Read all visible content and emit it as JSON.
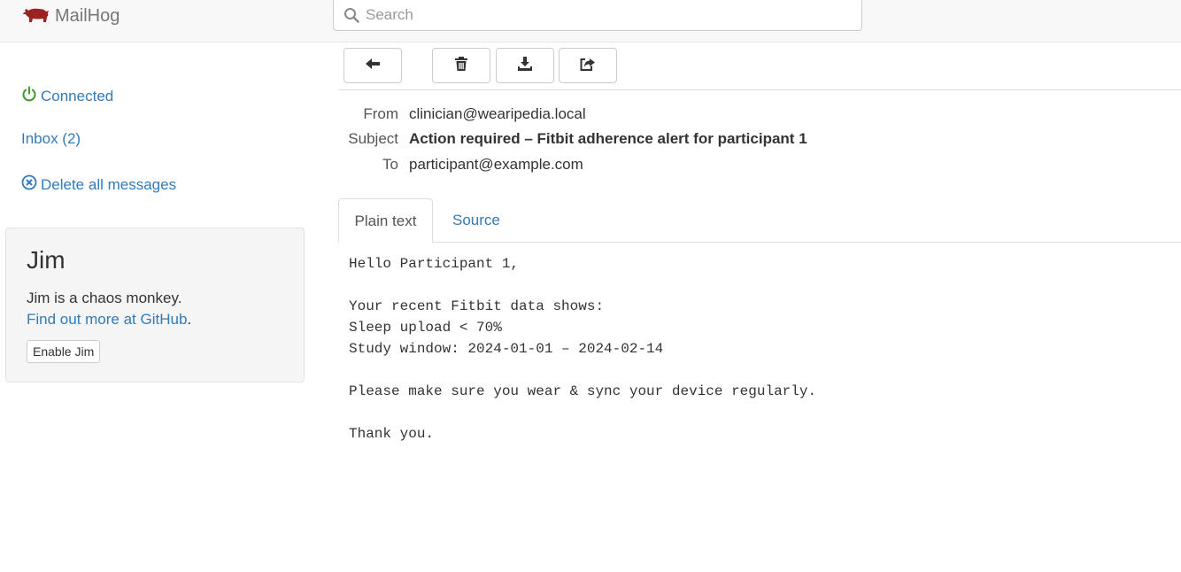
{
  "app": {
    "name": "MailHog"
  },
  "search": {
    "placeholder": "Search",
    "value": ""
  },
  "sidebar": {
    "connected": "Connected",
    "inbox": "Inbox (2)",
    "delete_all": "Delete all messages",
    "status_color": "#3c9a2c"
  },
  "jim": {
    "title": "Jim",
    "description": "Jim is a chaos monkey.",
    "link": "Find out more at GitHub",
    "link_suffix": ".",
    "button": "Enable Jim"
  },
  "toolbar": {
    "buttons": [
      {
        "icon": "back-arrow-icon"
      },
      {
        "icon": "trash-icon"
      },
      {
        "icon": "download-icon"
      },
      {
        "icon": "share-icon"
      }
    ]
  },
  "message": {
    "headers": {
      "from_label": "From",
      "from_value": "clinician@wearipedia.local",
      "subject_label": "Subject",
      "subject_value": "Action required – Fitbit adherence alert for participant 1",
      "to_label": "To",
      "to_value": "participant@example.com"
    },
    "tabs": [
      {
        "label": "Plain text",
        "active": true
      },
      {
        "label": "Source",
        "active": false
      }
    ],
    "body": "Hello Participant 1,\n\nYour recent Fitbit data shows:\nSleep upload < 70%\nStudy window: 2024-01-01 – 2024-02-14\n\nPlease make sure you wear & sync your device regularly.\n\nThank you."
  },
  "colors": {
    "brand": "#9b2323",
    "link": "#337ab7"
  }
}
